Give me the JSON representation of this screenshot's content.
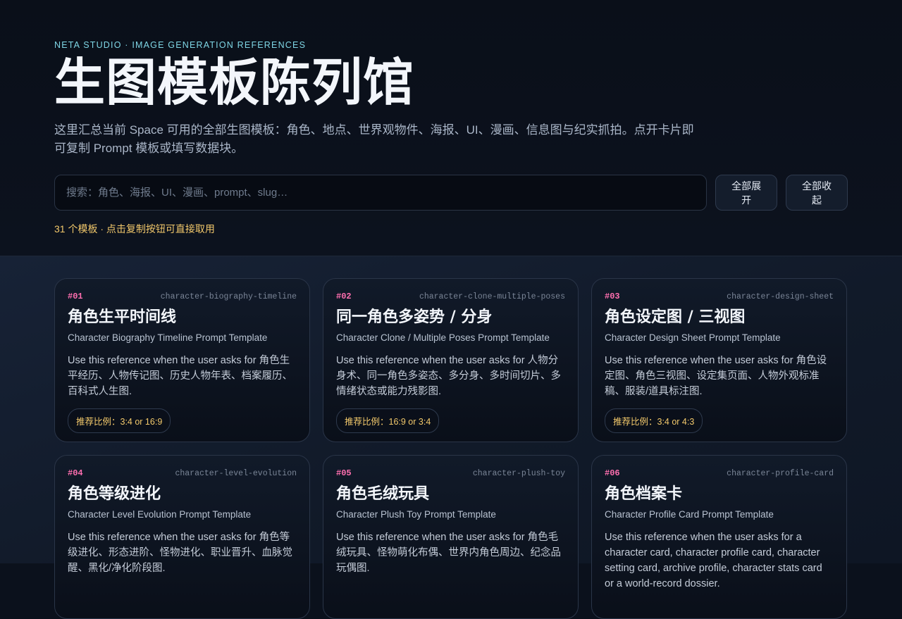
{
  "header": {
    "eyebrow": "NETA STUDIO · IMAGE GENERATION REFERENCES",
    "title": "生图模板陈列馆",
    "description": "这里汇总当前 Space 可用的全部生图模板：角色、地点、世界观物件、海报、UI、漫画、信息图与纪实抓拍。点开卡片即可复制 Prompt 模板或填写数据块。",
    "search_placeholder": "搜索：角色、海报、UI、漫画、prompt、slug…",
    "search_value": "",
    "expand_all": "全部展开",
    "collapse_all": "全部收起",
    "count_text": "31 个模板 · 点击复制按钮可直接取用"
  },
  "cards": [
    {
      "num": "#01",
      "slug": "character-biography-timeline",
      "title": "角色生平时间线",
      "subtitle": "Character Biography Timeline Prompt Template",
      "desc": "Use this reference when the user asks for 角色生平经历、人物传记图、历史人物年表、档案履历、百科式人生图.",
      "ratio": "推荐比例：3:4 or 16:9"
    },
    {
      "num": "#02",
      "slug": "character-clone-multiple-poses",
      "title": "同一角色多姿势 / 分身",
      "subtitle": "Character Clone / Multiple Poses Prompt Template",
      "desc": "Use this reference when the user asks for 人物分身术、同一角色多姿态、多分身、多时间切片、多情绪状态或能力残影图.",
      "ratio": "推荐比例：16:9 or 3:4"
    },
    {
      "num": "#03",
      "slug": "character-design-sheet",
      "title": "角色设定图 / 三视图",
      "subtitle": "Character Design Sheet Prompt Template",
      "desc": "Use this reference when the user asks for 角色设定图、角色三视图、设定集页面、人物外观标准稿、服装/道具标注图.",
      "ratio": "推荐比例：3:4 or 4:3"
    },
    {
      "num": "#04",
      "slug": "character-level-evolution",
      "title": "角色等级进化",
      "subtitle": "Character Level Evolution Prompt Template",
      "desc": "Use this reference when the user asks for 角色等级进化、形态进阶、怪物进化、职业晋升、血脉觉醒、黑化/净化阶段图.",
      "ratio": ""
    },
    {
      "num": "#05",
      "slug": "character-plush-toy",
      "title": "角色毛绒玩具",
      "subtitle": "Character Plush Toy Prompt Template",
      "desc": "Use this reference when the user asks for 角色毛绒玩具、怪物萌化布偶、世界内角色周边、纪念品玩偶图.",
      "ratio": ""
    },
    {
      "num": "#06",
      "slug": "character-profile-card",
      "title": "角色档案卡",
      "subtitle": "Character Profile Card Prompt Template",
      "desc": "Use this reference when the user asks for a character card, character profile card, character setting card, archive profile, character stats card or a world-record dossier.",
      "ratio": ""
    }
  ]
}
